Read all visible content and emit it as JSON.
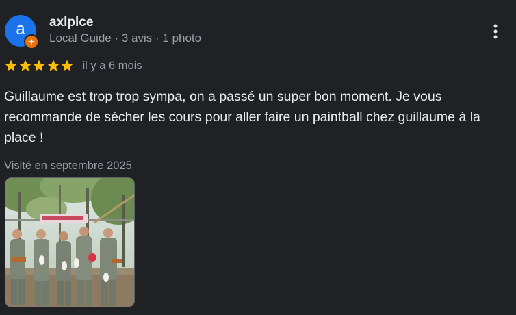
{
  "review": {
    "author": {
      "avatar_letter": "a",
      "name": "axlplce",
      "meta": "Local Guide · 3 avis · 1 photo"
    },
    "rating": 5,
    "max_rating": 5,
    "date": "il y a 6 mois",
    "text": "Guillaume est trop trop sympa, on a passé un super bon moment. Je vous recommande de sécher les cours pour aller faire un paintball chez guillaume à la place !",
    "visited": "Visité en septembre 2025"
  },
  "icons": {
    "menu": "more-vert-icon",
    "badge": "local-guide-badge-icon",
    "star": "star-icon"
  },
  "colors": {
    "background": "#202124",
    "avatar": "#1a73e8",
    "badge": "#e8710a",
    "star": "#fbbc04",
    "text_primary": "#e8eaed",
    "text_secondary": "#9aa0a6"
  }
}
